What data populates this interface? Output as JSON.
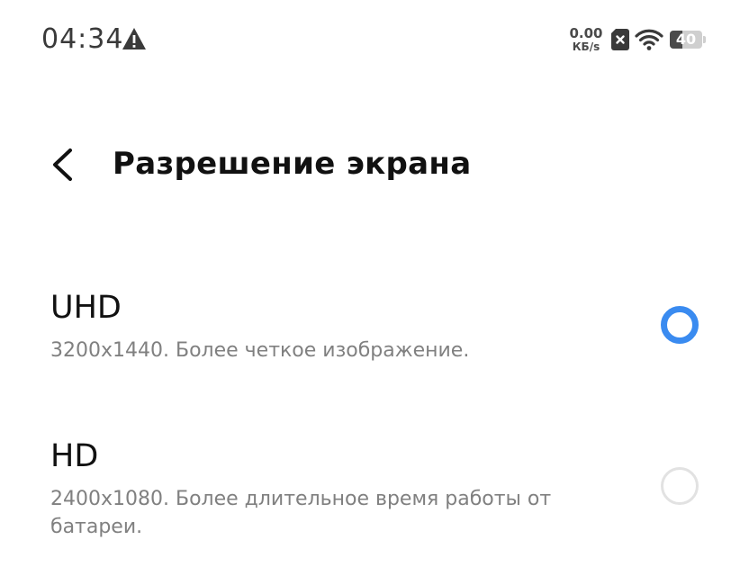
{
  "status_bar": {
    "time": "04:34",
    "net_speed_value": "0.00",
    "net_speed_unit": "КБ/s",
    "battery_level": "40",
    "battery_fraction": 0.4,
    "icons": [
      "warning-icon",
      "sim-icon",
      "wifi-icon",
      "battery-icon"
    ]
  },
  "header": {
    "back_icon": "chevron-left-icon",
    "title": "Разрешение экрана"
  },
  "options": [
    {
      "title": "UHD",
      "description": "3200x1440. Более четкое изображение.",
      "selected": true
    },
    {
      "title": "HD",
      "description": "2400x1080. Более длительное время работы от батареи.",
      "selected": false
    }
  ],
  "colors": {
    "accent": "#3a8bf0",
    "title_text": "#111111",
    "secondary_text": "#808080",
    "radio_unselected": "#e2e2e2"
  }
}
